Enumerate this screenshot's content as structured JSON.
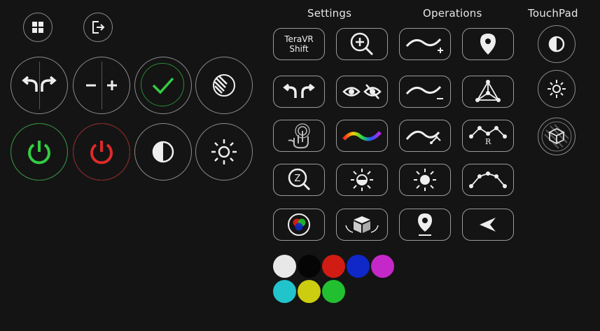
{
  "headers": {
    "settings": "Settings",
    "operations": "Operations",
    "touchpad": "TouchPad"
  },
  "settings": {
    "teravr_line1": "TeraVR",
    "teravr_line2": "Shift"
  },
  "operations": {
    "r_label": "R"
  },
  "colors": {
    "power_on": "#33cc44",
    "power_off": "#dd2a2a",
    "check": "#33cc44",
    "swatches": [
      "#e8e8e8",
      "#050505",
      "#d01c12",
      "#1028c8",
      "#c428c8",
      "#22c4cc",
      "#cccc10",
      "#22c030"
    ]
  }
}
